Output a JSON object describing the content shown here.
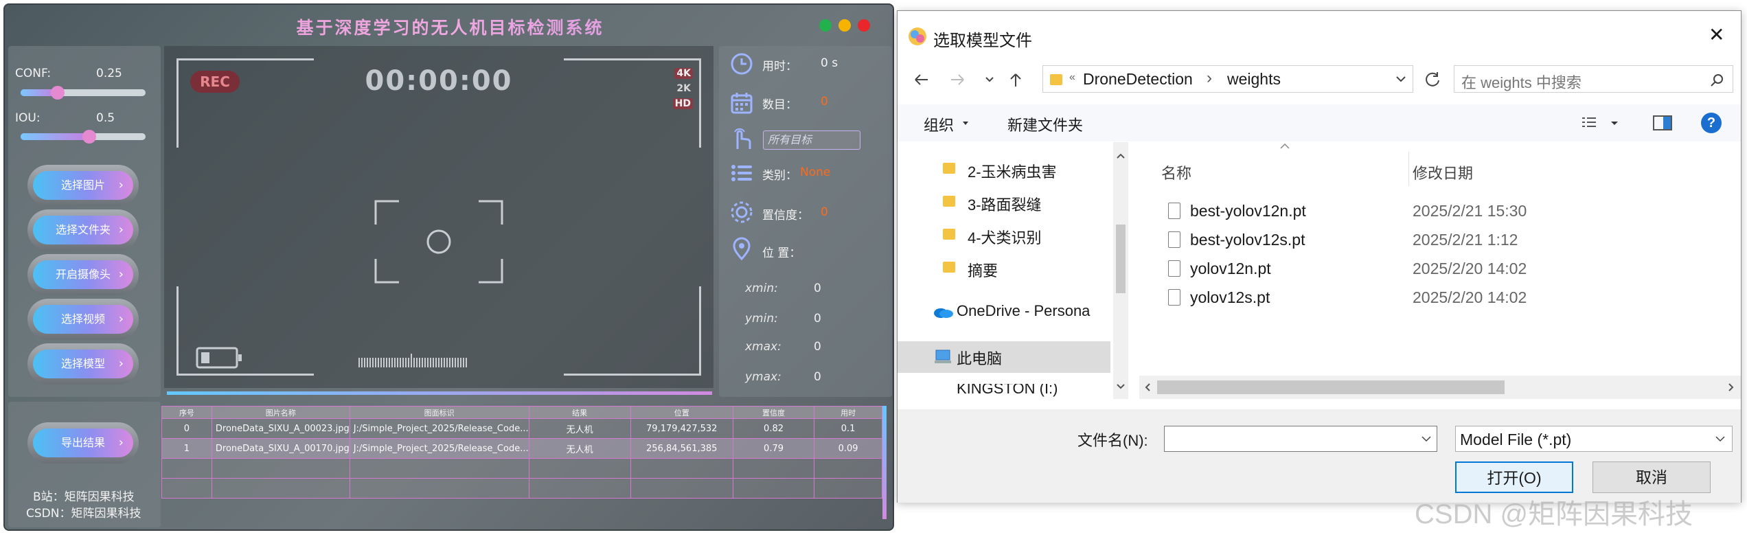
{
  "app": {
    "title": "基于深度学习的无人机目标检测系统",
    "conf_label": "CONF:",
    "conf_value": "0.25",
    "conf_level": 0.25,
    "iou_label": "IOU:",
    "iou_value": "0.5",
    "iou_level": 0.5,
    "buttons": {
      "select_image": "选择图片",
      "select_folder": "选择文件夹",
      "open_camera": "开启摄像头",
      "select_video": "选择视频",
      "select_model": "选择模型",
      "export": "导出结果",
      "chevron": "›"
    },
    "credits": {
      "bilibili": "B站：矩阵因果科技",
      "csdn": "CSDN：矩阵因果科技"
    },
    "video": {
      "rec": "REC",
      "timer": "00:00:00",
      "res_4k": "4K",
      "res_2k": "2K",
      "res_hd": "HD"
    },
    "info": {
      "time_label": "用时：",
      "time_value": "0 s",
      "count_label": "数目：",
      "count_value": "0",
      "target_select": "所有目标",
      "class_label": "类别：",
      "class_value": "None",
      "conf_label": "置信度：",
      "conf_value": "0",
      "pos_label": "位 置：",
      "xmin_label": "xmin:",
      "xmin_value": "0",
      "ymin_label": "ymin:",
      "ymin_value": "0",
      "xmax_label": "xmax:",
      "xmax_value": "0",
      "ymax_label": "ymax:",
      "ymax_value": "0"
    },
    "table": {
      "headers": [
        "序号",
        "图片名称",
        "图面标识",
        "结果",
        "位置",
        "置信度",
        "用时"
      ],
      "rows": [
        [
          "0",
          "DroneData_SIXU_A_00023.jpg",
          "J:/Simple_Project_2025/Release_Code...",
          "无人机",
          "79,179,427,532",
          "0.82",
          "0.1"
        ],
        [
          "1",
          "DroneData_SIXU_A_00170.jpg",
          "J:/Simple_Project_2025/Release_Code...",
          "无人机",
          "256,84,561,385",
          "0.79",
          "0.09"
        ]
      ]
    },
    "colors": {
      "accent_pink": "#e79ad8",
      "value_orange": "#ff6a1a",
      "win_green": "#22b14c",
      "win_yellow": "#f6b400",
      "win_red": "#e8262b"
    }
  },
  "dialog": {
    "title": "选取模型文件",
    "close": "✕",
    "breadcrumb": {
      "sep": "«",
      "folder1": "DroneDetection",
      "arrow": "›",
      "folder2": "weights"
    },
    "search_placeholder": "在 weights 中搜索",
    "organize": "组织",
    "new_folder": "新建文件夹",
    "help": "?",
    "nav_items": [
      "2-玉米病虫害",
      "3-路面裂缝",
      "4-犬类识别",
      "摘要",
      "OneDrive - Persona",
      "此电脑",
      "KINGSTON (I:)"
    ],
    "col_name": "名称",
    "col_date": "修改日期",
    "files": [
      {
        "name": "best-yolov12n.pt",
        "date": "2025/2/21 15:30"
      },
      {
        "name": "best-yolov12s.pt",
        "date": "2025/2/21 1:12"
      },
      {
        "name": "yolov12n.pt",
        "date": "2025/2/20 14:02"
      },
      {
        "name": "yolov12s.pt",
        "date": "2025/2/20 14:02"
      }
    ],
    "filename_label": "文件名(N):",
    "filename_value": "",
    "filetype": "Model File (*.pt)",
    "open_button": "打开(O)",
    "cancel_button": "取消"
  },
  "watermark": "CSDN @矩阵因果科技"
}
